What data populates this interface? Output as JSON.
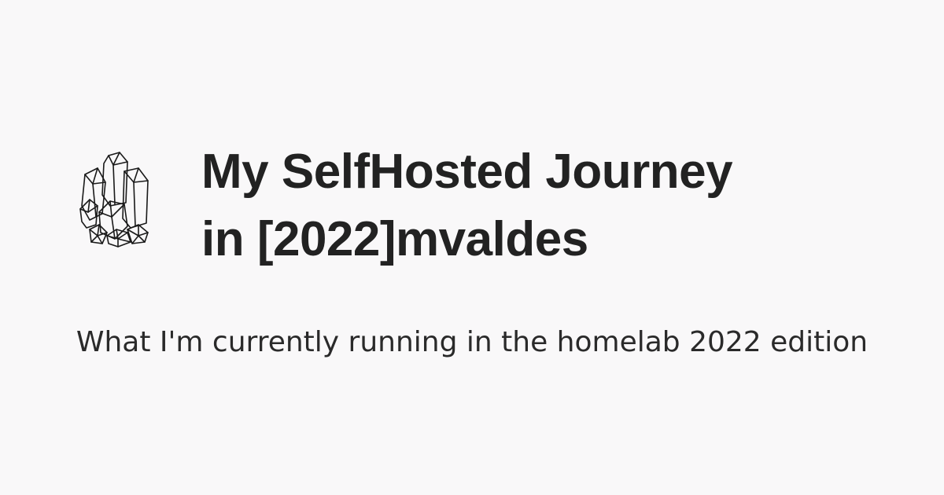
{
  "card": {
    "logo_icon": "crystal-cluster-icon",
    "title_line1": "My SelfHosted Journey",
    "title_line2": "in [2022]mvaldes",
    "subtitle": "What I'm currently running in the homelab 2022 edition",
    "colors": {
      "background": "#f9f8f9",
      "text": "#222222"
    }
  }
}
